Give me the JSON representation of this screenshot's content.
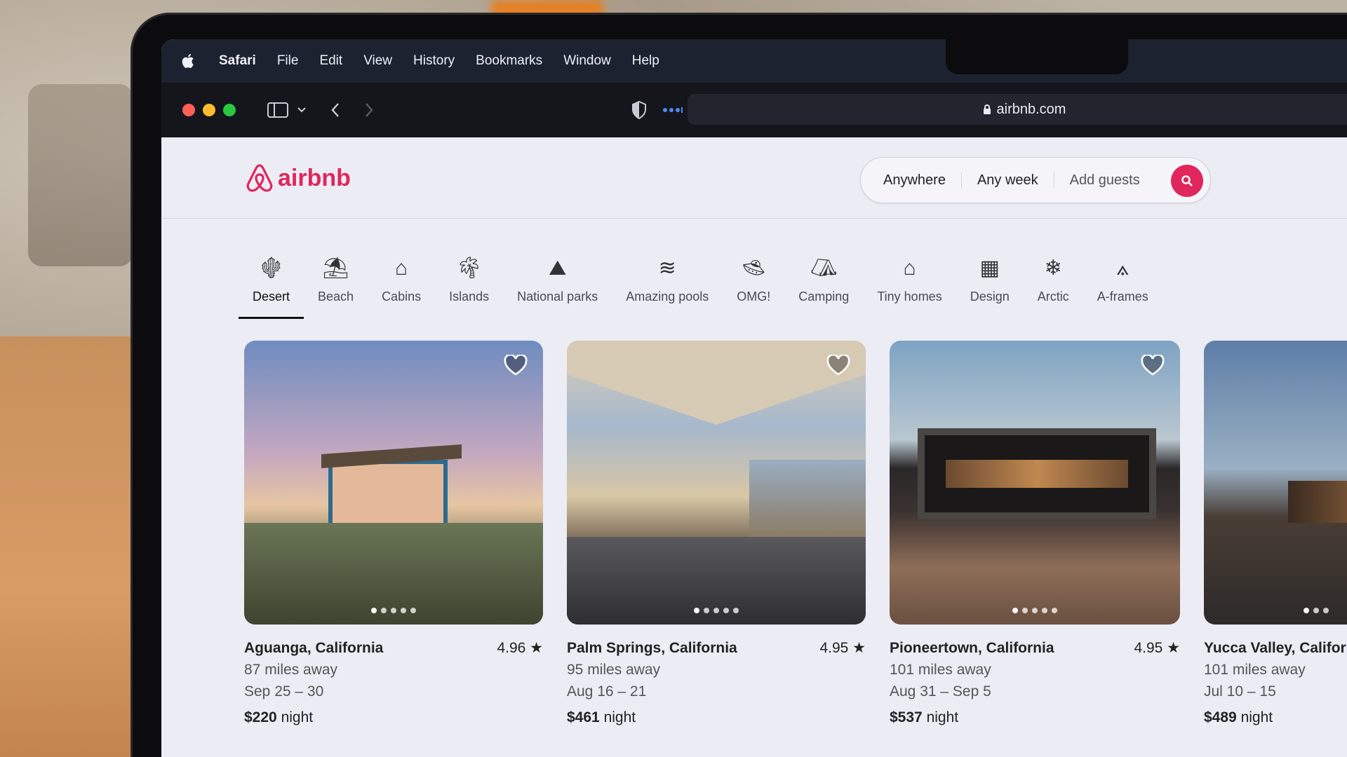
{
  "menubar": {
    "app": "Safari",
    "items": [
      "File",
      "Edit",
      "View",
      "History",
      "Bookmarks",
      "Window",
      "Help"
    ]
  },
  "toolbar": {
    "url": "airbnb.com",
    "traffic_lights": [
      "#ff5f57",
      "#febc2e",
      "#28c840"
    ]
  },
  "brand": {
    "name": "airbnb",
    "color": "#e0265c"
  },
  "search": {
    "where": "Anywhere",
    "when": "Any week",
    "who": "Add guests"
  },
  "categories": [
    {
      "label": "Desert",
      "icon": "cactus-icon",
      "active": true
    },
    {
      "label": "Beach",
      "icon": "umbrella-icon"
    },
    {
      "label": "Cabins",
      "icon": "cabin-icon"
    },
    {
      "label": "Islands",
      "icon": "palm-icon"
    },
    {
      "label": "National parks",
      "icon": "park-icon"
    },
    {
      "label": "Amazing pools",
      "icon": "pool-icon"
    },
    {
      "label": "OMG!",
      "icon": "ufo-icon"
    },
    {
      "label": "Camping",
      "icon": "tent-icon"
    },
    {
      "label": "Tiny homes",
      "icon": "tiny-home-icon"
    },
    {
      "label": "Design",
      "icon": "building-icon"
    },
    {
      "label": "Arctic",
      "icon": "snowflake-icon"
    },
    {
      "label": "A-frames",
      "icon": "a-frame-icon"
    }
  ],
  "listings": [
    {
      "location": "Aguanga, California",
      "rating": "4.96",
      "distance": "87 miles away",
      "dates": "Sep 25 – 30",
      "price": "$220",
      "unit": "night"
    },
    {
      "location": "Palm Springs, California",
      "rating": "4.95",
      "distance": "95 miles away",
      "dates": "Aug 16 – 21",
      "price": "$461",
      "unit": "night"
    },
    {
      "location": "Pioneertown, California",
      "rating": "4.95",
      "distance": "101 miles away",
      "dates": "Aug 31 – Sep 5",
      "price": "$537",
      "unit": "night"
    },
    {
      "location": "Yucca Valley, Califor",
      "rating": "",
      "distance": "101 miles away",
      "dates": "Jul 10 – 15",
      "price": "$489",
      "unit": "night"
    }
  ]
}
